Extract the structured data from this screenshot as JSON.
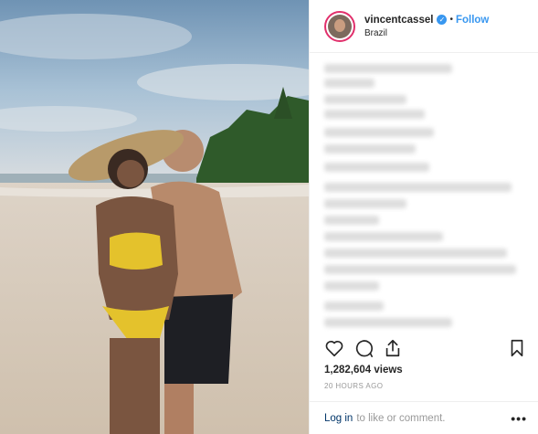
{
  "header": {
    "username": "vincentcassel",
    "separator": "•",
    "follow_label": "Follow",
    "location": "Brazil"
  },
  "icons": {
    "like": "heart-icon",
    "comment": "comment-icon",
    "share": "share-icon",
    "save": "bookmark-icon",
    "verified": "verified-badge-icon",
    "more": "more-options-icon"
  },
  "stats": {
    "views": "1,282,604 views",
    "time": "20 HOURS AGO"
  },
  "footer": {
    "login_label": "Log in",
    "rest_text": "to like or comment.",
    "more_label": "•••"
  },
  "colors": {
    "accent": "#3897f0",
    "story_ring": "#e1306c",
    "link_dark": "#003569"
  }
}
